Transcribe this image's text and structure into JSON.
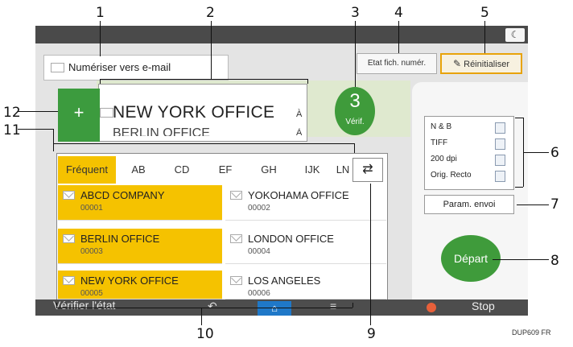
{
  "callouts": [
    "1",
    "2",
    "3",
    "4",
    "5",
    "6",
    "7",
    "8",
    "9",
    "10",
    "11",
    "12"
  ],
  "caption": "DUP609 FR",
  "header": {
    "scan_mode": "Numériser vers e-mail",
    "file_status_button": "Etat fich. numér.",
    "reset_button": "Réinitialiser",
    "night_icon": "moon-icon"
  },
  "destination": {
    "name": "NEW YORK OFFICE",
    "name2": "BERLIN OFFICE",
    "flag": "À",
    "flag2": "À",
    "count": "3",
    "count_label": "Vérif.",
    "add_label": "+"
  },
  "tabs": [
    "Fréquent",
    "AB",
    "CD",
    "EF",
    "GH",
    "IJK",
    "LN"
  ],
  "active_tab": "Fréquent",
  "contacts": [
    {
      "name": "ABCD COMPANY",
      "number": "00001"
    },
    {
      "name": "YOKOHAMA OFFICE",
      "number": "00002"
    },
    {
      "name": "BERLIN OFFICE",
      "number": "00003"
    },
    {
      "name": "LONDON OFFICE",
      "number": "00004"
    },
    {
      "name": "NEW YORK OFFICE",
      "number": "00005"
    },
    {
      "name": "LOS ANGELES",
      "number": "00006"
    }
  ],
  "settings": {
    "color": "N & B",
    "format": "TIFF",
    "resolution": "200 dpi",
    "sides": "Orig. Recto",
    "param_button": "Param. envoi"
  },
  "start_button": "Départ",
  "bottom": {
    "status_label": "Vérifier l'état",
    "stop_label": "Stop"
  },
  "colors": {
    "accent_green": "#3f9b3b",
    "favorite_yellow": "#f5c200",
    "reset_border": "#e8a30a",
    "home_blue": "#1f78c8"
  }
}
